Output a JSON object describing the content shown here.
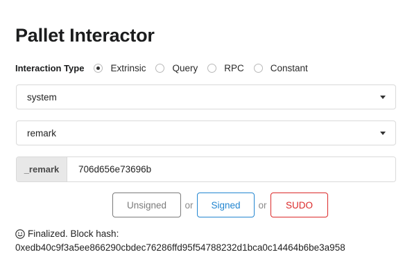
{
  "page": {
    "title": "Pallet Interactor"
  },
  "interaction": {
    "label": "Interaction Type",
    "options": [
      {
        "label": "Extrinsic",
        "selected": true
      },
      {
        "label": "Query",
        "selected": false
      },
      {
        "label": "RPC",
        "selected": false
      },
      {
        "label": "Constant",
        "selected": false
      }
    ]
  },
  "pallet_select": {
    "value": "system"
  },
  "callable_select": {
    "value": "remark"
  },
  "param": {
    "label": "_remark",
    "value": "706d656e73696b"
  },
  "actions": {
    "unsigned_label": "Unsigned",
    "or_text": "or",
    "signed_label": "Signed",
    "sudo_label": "SUDO"
  },
  "status": {
    "icon": "smile-icon",
    "message": "Finalized. Block hash:",
    "hash": "0xedb40c9f3a5ee866290cbdec76286ffd95f54788232d1bca0c14464b6be3a958"
  },
  "colors": {
    "signed": "#2185d0",
    "sudo": "#db2828",
    "unsigned": "#7a7a7a"
  }
}
